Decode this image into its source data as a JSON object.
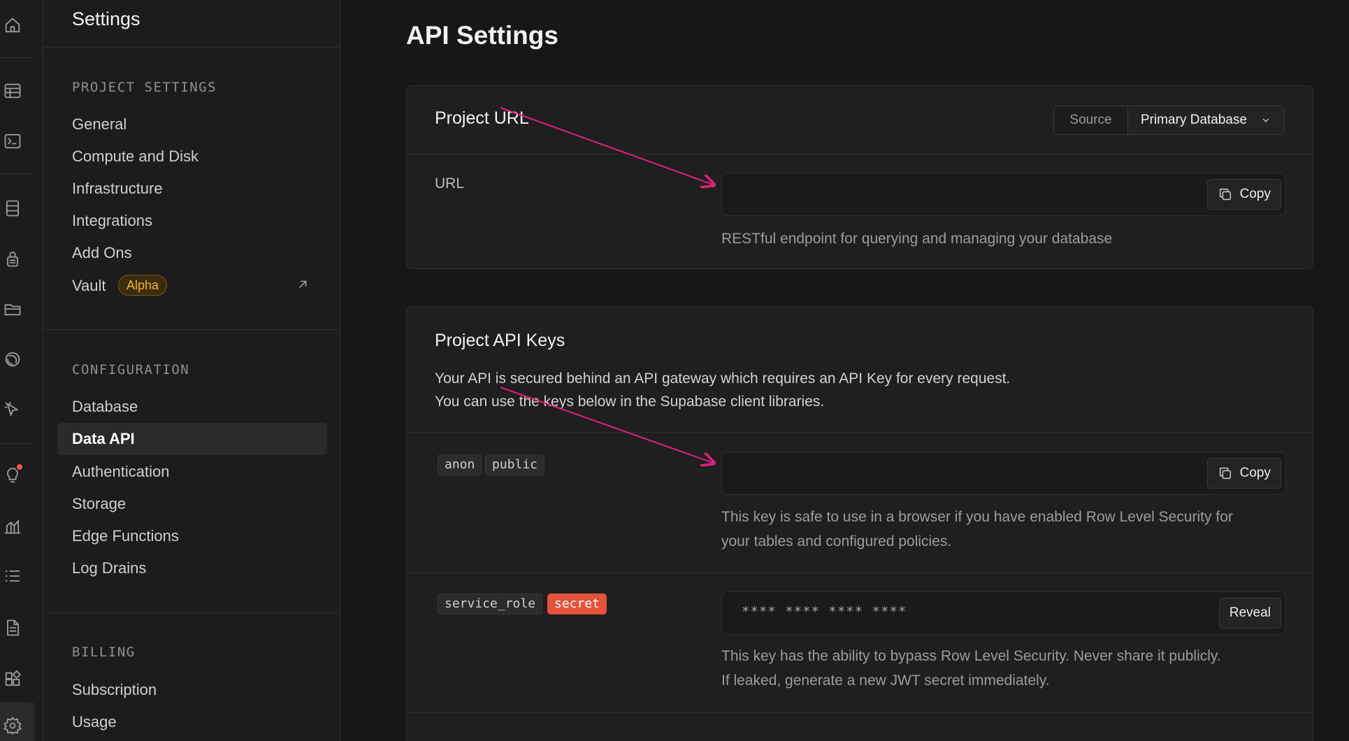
{
  "sidebar": {
    "title": "Settings",
    "sections": {
      "project_settings": {
        "label": "PROJECT SETTINGS",
        "items": [
          "General",
          "Compute and Disk",
          "Infrastructure",
          "Integrations",
          "Add Ons",
          "Vault"
        ],
        "vault_badge": "Alpha"
      },
      "configuration": {
        "label": "CONFIGURATION",
        "items": [
          "Database",
          "Data API",
          "Authentication",
          "Storage",
          "Edge Functions",
          "Log Drains"
        ],
        "active": "Data API"
      },
      "billing": {
        "label": "BILLING",
        "items": [
          "Subscription",
          "Usage"
        ]
      }
    }
  },
  "main": {
    "page_title": "API Settings",
    "project_url_card": {
      "heading": "Project URL",
      "source_label": "Source",
      "source_value": "Primary Database",
      "url_label": "URL",
      "url_value": "",
      "copy_label": "Copy",
      "helper": "RESTful endpoint for querying and managing your database"
    },
    "api_keys_card": {
      "heading": "Project API Keys",
      "description_line1": "Your API is secured behind an API gateway which requires an API Key for every request.",
      "description_line2": "You can use the keys below in the Supabase client libraries.",
      "anon": {
        "tags": [
          "anon",
          "public"
        ],
        "value": "",
        "copy_label": "Copy",
        "helper_line1": "This key is safe to use in a browser if you have enabled Row Level Security for",
        "helper_line2": "your tables and configured policies."
      },
      "service_role": {
        "tags": [
          "service_role",
          "secret"
        ],
        "masked_value": "**** **** **** ****",
        "reveal_label": "Reveal",
        "helper_line1": "This key has the ability to bypass Row Level Security. Never share it publicly.",
        "helper_line2": "If leaked, generate a new JWT secret immediately."
      }
    }
  },
  "icons": {
    "rail": [
      "home-icon",
      "table-editor-icon",
      "sql-editor-icon",
      "database-icon",
      "auth-lock-icon",
      "storage-folder-icon",
      "realtime-icon",
      "edge-functions-icon",
      "advisors-bulb-icon",
      "reports-chart-icon",
      "logs-list-icon",
      "api-docs-icon",
      "integrations-icon",
      "settings-gear-icon"
    ]
  },
  "colors": {
    "accent_arrow": "#e0207c",
    "secret_badge": "#e5533d",
    "alpha_badge": "#f0b429",
    "notification_dot": "#f2555a"
  }
}
